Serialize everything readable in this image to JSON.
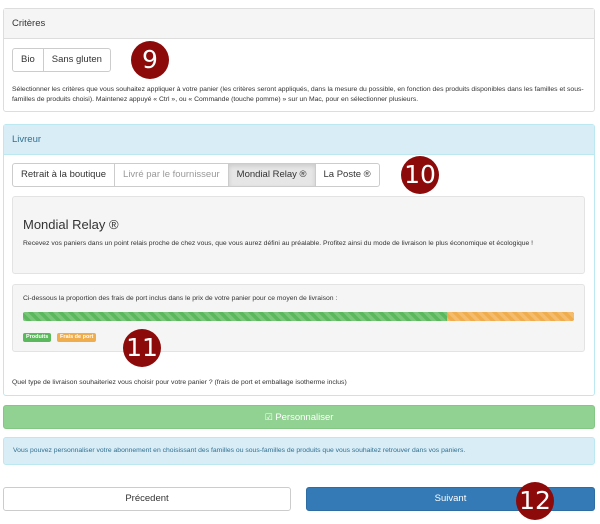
{
  "criteres": {
    "title": "Critères",
    "buttons": [
      "Bio",
      "Sans gluten"
    ],
    "help": "Sélectionner les critères que vous souhaitez appliquer à votre panier (les critères seront appliqués, dans la mesure du possible, en fonction des produits disponibles dans les familles et sous-familles de produits choisi). Maintenez appuyé « Ctrl », ou « Commande (touche pomme) » sur un Mac, pour en sélectionner plusieurs."
  },
  "livreur": {
    "title": "Livreur",
    "tabs": [
      "Retrait à la boutique",
      "Livré par le fournisseur",
      "Mondial Relay ®",
      "La Poste ®"
    ],
    "selected_tab": "Mondial Relay ®",
    "detail_title": "Mondial Relay ®",
    "detail_text": "Recevez vos paniers dans un point relais proche de chez vous, que vous aurez défini au préalable. Profitez ainsi du mode de livraison le plus économique et écologique !",
    "proportion_text": "Ci-dessous la proportion des frais de port inclus dans le prix de votre panier pour ce moyen de livraison :",
    "products_fraction": 0.77,
    "shipping_fraction": 0.23,
    "legend_products": "Produits",
    "legend_shipping": "Frais de port",
    "question": "Quel type de livraison souhaiteriez vous choisir pour votre panier ? (frais de port et emballage isotherme inclus)"
  },
  "customize_button": "Personnaliser",
  "info_text": "Vous pouvez personnaliser votre abonnement en choisissant des familles ou sous-familles de produits que vous souhaitez retrouver dans vos paniers.",
  "nav": {
    "previous": "Précedent",
    "next": "Suivant"
  },
  "markers": [
    "9",
    "10",
    "11",
    "12"
  ],
  "colors": {
    "products": "#5cb85c",
    "shipping": "#f0ad4e",
    "primary": "#337ab7",
    "success_disabled": "#91d191",
    "marker": "#8c0a0a"
  }
}
